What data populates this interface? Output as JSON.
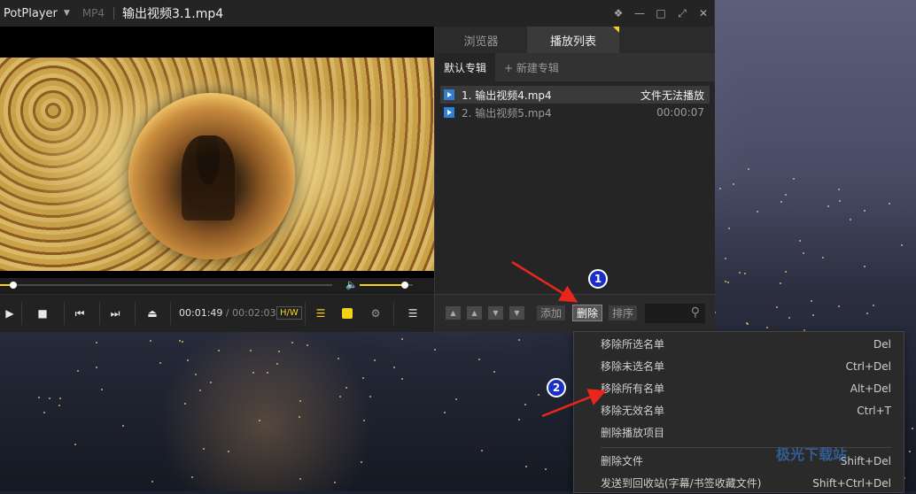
{
  "titlebar": {
    "app_name": "PotPlayer",
    "format": "MP4",
    "file_title": "输出视频3.1.mp4"
  },
  "controls": {
    "time_current": "00:01:49",
    "time_separator": "/",
    "time_total": "00:02:03",
    "hw_label": "H/W",
    "seek_progress": 0.04,
    "volume_level": 0.85
  },
  "panel": {
    "tabs": [
      "浏览器",
      "播放列表"
    ],
    "subtabs": [
      "默认专辑",
      "+ 新建专辑"
    ],
    "items": [
      {
        "name": "1. 输出视频4.mp4",
        "info": "文件无法播放"
      },
      {
        "name": "2. 输出视频5.mp4",
        "info": "00:00:07"
      }
    ],
    "footer_buttons": [
      "添加",
      "删除",
      "排序"
    ]
  },
  "menu": {
    "items": [
      {
        "label": "移除所选名单",
        "key": "Del"
      },
      {
        "label": "移除未选名单",
        "key": "Ctrl+Del"
      },
      {
        "label": "移除所有名单",
        "key": "Alt+Del"
      },
      {
        "label": "移除无效名单",
        "key": "Ctrl+T"
      },
      {
        "label": "删除播放项目",
        "key": ""
      },
      {
        "label": "删除文件",
        "key": "Shift+Del"
      },
      {
        "label": "发送到回收站(字幕/书签收藏文件)",
        "key": "Shift+Ctrl+Del"
      }
    ]
  },
  "annotations": {
    "badge1": "1",
    "badge2": "2",
    "arrow_color": "#e8261c"
  },
  "watermark": "极光下载站"
}
